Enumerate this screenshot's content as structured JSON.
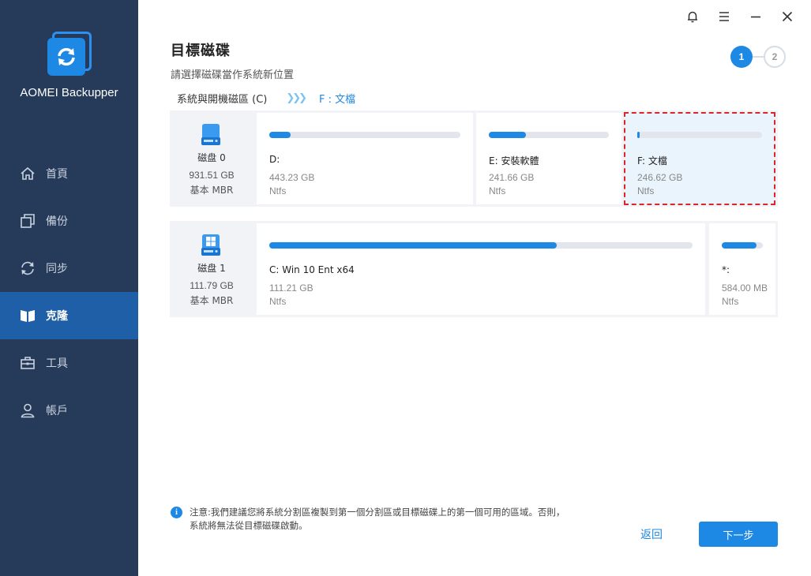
{
  "app": {
    "name": "AOMEI Backupper"
  },
  "sidebar": {
    "items": [
      {
        "label": "首頁",
        "icon": "home-icon"
      },
      {
        "label": "備份",
        "icon": "backup-icon"
      },
      {
        "label": "同步",
        "icon": "sync-icon"
      },
      {
        "label": "克隆",
        "icon": "clone-icon",
        "active": true
      },
      {
        "label": "工具",
        "icon": "tools-icon"
      },
      {
        "label": "帳戶",
        "icon": "account-icon"
      }
    ]
  },
  "window_controls": [
    "bell-icon",
    "menu-icon",
    "minimize-icon",
    "close-icon"
  ],
  "header": {
    "title": "目標磁碟",
    "subtitle": "請選擇磁碟當作系統新位置",
    "steps": [
      "1",
      "2"
    ],
    "active_step": 1
  },
  "breadcrumb": {
    "source": "系統與開機磁區 (C)",
    "arrows": "❯❯❯",
    "target": "F : 文檔"
  },
  "disks": [
    {
      "name": "磁盘 0",
      "size": "931.51 GB",
      "type": "基本 MBR",
      "partitions": [
        {
          "name": "D:",
          "size": "443.23 GB",
          "fs": "Ntfs",
          "used_fraction": 0.11
        },
        {
          "name": "E: 安裝軟體",
          "size": "241.66 GB",
          "fs": "Ntfs",
          "used_fraction": 0.31
        },
        {
          "name": "F: 文檔",
          "size": "246.62 GB",
          "fs": "Ntfs",
          "used_fraction": 0.02,
          "selected": true
        }
      ]
    },
    {
      "name": "磁盘 1",
      "size": "111.79 GB",
      "type": "基本 MBR",
      "partitions": [
        {
          "name": "C: Win 10 Ent x64",
          "size": "111.21 GB",
          "fs": "Ntfs",
          "used_fraction": 0.68
        },
        {
          "name": "*:",
          "size": "584.00 MB",
          "fs": "Ntfs",
          "used_fraction": 0.85
        }
      ]
    }
  ],
  "footer": {
    "note": "注意:我們建議您將系統分割區複製到第一個分割區或目標磁碟上的第一個可用的區域。否則，系統將無法從目標磁碟啟動。",
    "back_label": "返回",
    "next_label": "下一步"
  },
  "colors": {
    "accent": "#1e88e5",
    "sidebar": "#263a59",
    "sidebar_active": "#1e5fa8",
    "selection_border": "#d9262c"
  }
}
